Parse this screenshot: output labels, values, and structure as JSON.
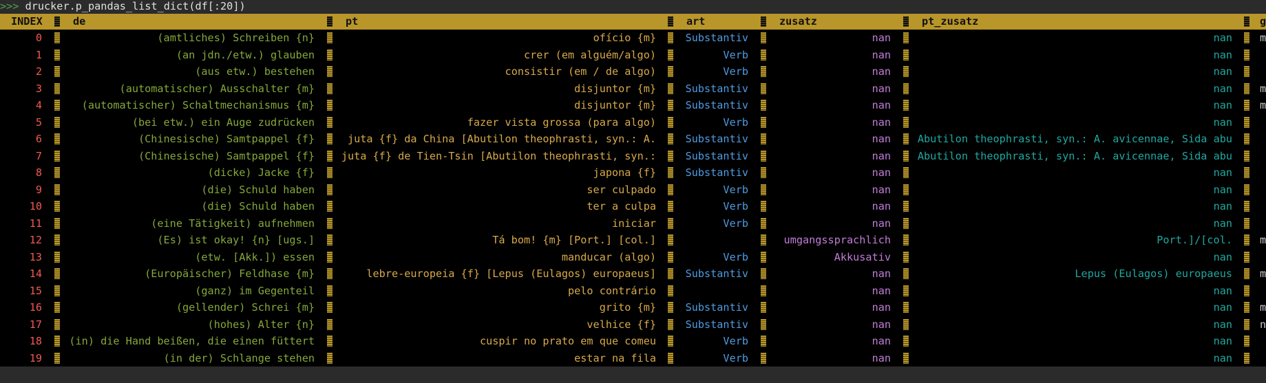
{
  "terminal": {
    "prompt": ">>>",
    "command": " drucker.p_pandas_list_dict(df[:20])"
  },
  "table": {
    "headers": {
      "index": "INDEX",
      "de": "de",
      "pt": "pt",
      "art": "art",
      "zusatz": "zusatz",
      "pt_zusatz": "pt_zusatz",
      "g": "g"
    },
    "rows": [
      {
        "index": "0",
        "de": "(amtliches) Schreiben {n}",
        "pt": "ofício {m}",
        "art": "Substantiv",
        "zusatz": "nan",
        "pt_zusatz": "nan",
        "g": "m"
      },
      {
        "index": "1",
        "de": "(an jdn./etw.) glauben",
        "pt": "crer (em alguém/algo)",
        "art": "Verb",
        "zusatz": "nan",
        "pt_zusatz": "nan",
        "g": ""
      },
      {
        "index": "2",
        "de": "(aus etw.) bestehen",
        "pt": "consistir (em / de algo)",
        "art": "Verb",
        "zusatz": "nan",
        "pt_zusatz": "nan",
        "g": ""
      },
      {
        "index": "3",
        "de": "(automatischer) Ausschalter {m}",
        "pt": "disjuntor {m}",
        "art": "Substantiv",
        "zusatz": "nan",
        "pt_zusatz": "nan",
        "g": "m"
      },
      {
        "index": "4",
        "de": "(automatischer) Schaltmechanismus {m}",
        "pt": "disjuntor {m}",
        "art": "Substantiv",
        "zusatz": "nan",
        "pt_zusatz": "nan",
        "g": "m"
      },
      {
        "index": "5",
        "de": "(bei etw.) ein Auge zudrücken",
        "pt": "fazer vista grossa (para algo)",
        "art": "Verb",
        "zusatz": "nan",
        "pt_zusatz": "nan",
        "g": ""
      },
      {
        "index": "6",
        "de": "(Chinesische) Samtpappel {f}",
        "pt": "juta {f} da China [Abutilon theophrasti, syn.: A.",
        "art": "Substantiv",
        "zusatz": "nan",
        "pt_zusatz": "Abutilon theophrasti, syn.: A. avicennae, Sida abu",
        "g": ""
      },
      {
        "index": "7",
        "de": "(Chinesische) Samtpappel {f}",
        "pt": "juta {f} de Tien-Tsin [Abutilon theophrasti, syn.:",
        "art": "Substantiv",
        "zusatz": "nan",
        "pt_zusatz": "Abutilon theophrasti, syn.: A. avicennae, Sida abu",
        "g": ""
      },
      {
        "index": "8",
        "de": "(dicke) Jacke {f}",
        "pt": "japona {f}",
        "art": "Substantiv",
        "zusatz": "nan",
        "pt_zusatz": "nan",
        "g": ""
      },
      {
        "index": "9",
        "de": "(die) Schuld haben",
        "pt": "ser culpado",
        "art": "Verb",
        "zusatz": "nan",
        "pt_zusatz": "nan",
        "g": ""
      },
      {
        "index": "10",
        "de": "(die) Schuld haben",
        "pt": "ter a culpa",
        "art": "Verb",
        "zusatz": "nan",
        "pt_zusatz": "nan",
        "g": ""
      },
      {
        "index": "11",
        "de": "(eine Tätigkeit) aufnehmen",
        "pt": "iniciar",
        "art": "Verb",
        "zusatz": "nan",
        "pt_zusatz": "nan",
        "g": ""
      },
      {
        "index": "12",
        "de": "(Es) ist okay! {n} [ugs.]",
        "pt": "Tá bom! {m} [Port.] [col.]",
        "art": "",
        "zusatz": "umgangssprachlich",
        "pt_zusatz": "Port.]/[col.",
        "g": "m"
      },
      {
        "index": "13",
        "de": "(etw. [Akk.]) essen",
        "pt": "manducar (algo)",
        "art": "Verb",
        "zusatz": "Akkusativ",
        "pt_zusatz": "nan",
        "g": ""
      },
      {
        "index": "14",
        "de": "(Europäischer) Feldhase {m}",
        "pt": "lebre-europeia {f} [Lepus (Eulagos) europaeus]",
        "art": "Substantiv",
        "zusatz": "nan",
        "pt_zusatz": "Lepus (Eulagos) europaeus",
        "g": "m"
      },
      {
        "index": "15",
        "de": "(ganz) im Gegenteil",
        "pt": "pelo contrário",
        "art": "",
        "zusatz": "nan",
        "pt_zusatz": "nan",
        "g": ""
      },
      {
        "index": "16",
        "de": "(gellender) Schrei {m}",
        "pt": "grito {m}",
        "art": "Substantiv",
        "zusatz": "nan",
        "pt_zusatz": "nan",
        "g": "m"
      },
      {
        "index": "17",
        "de": "(hohes) Alter {n}",
        "pt": "velhice {f}",
        "art": "Substantiv",
        "zusatz": "nan",
        "pt_zusatz": "nan",
        "g": "n"
      },
      {
        "index": "18",
        "de": "(in) die Hand beißen, die einen füttert",
        "pt": "cuspir no prato em que comeu",
        "art": "Verb",
        "zusatz": "nan",
        "pt_zusatz": "nan",
        "g": ""
      },
      {
        "index": "19",
        "de": "(in der) Schlange stehen",
        "pt": "estar na fila",
        "art": "Verb",
        "zusatz": "nan",
        "pt_zusatz": "nan",
        "g": ""
      }
    ]
  },
  "colors": {
    "header_bg": "#b8962a",
    "index": "#f05a4f",
    "de": "#85a83a",
    "pt": "#d8a94a",
    "art": "#4f9be0",
    "zusatz": "#c07ed8",
    "pt_zusatz": "#1fa8a0"
  }
}
